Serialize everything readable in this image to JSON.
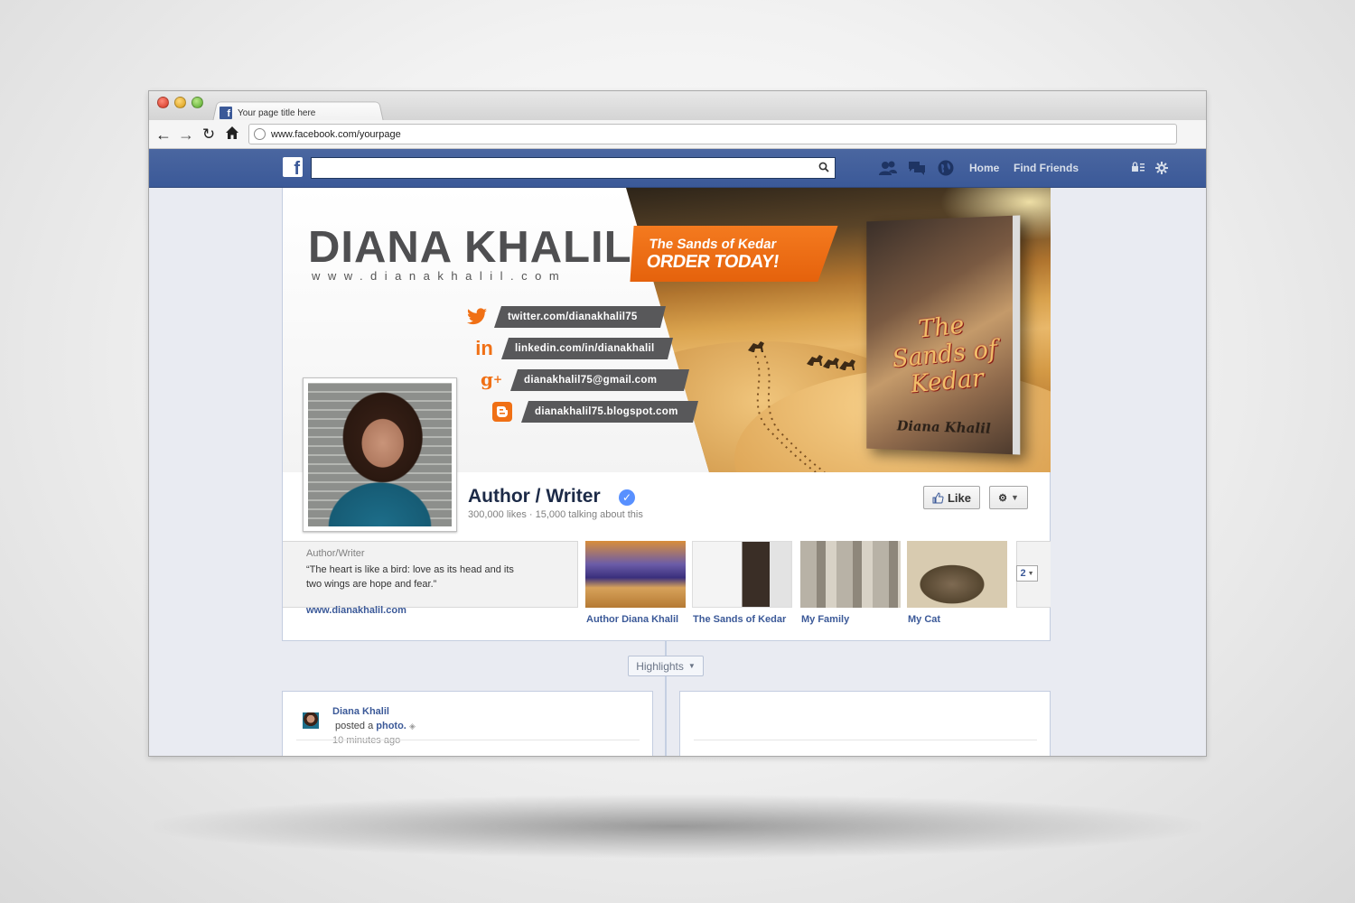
{
  "browser": {
    "tab_title": "Your page title here",
    "url": "www.facebook.com/yourpage"
  },
  "fb_nav": {
    "search_placeholder": "",
    "home_label": "Home",
    "find_friends_label": "Find Friends"
  },
  "cover": {
    "author_name": "DIANA KHALIL",
    "website": "www.dianakhalil.com",
    "promo_line1": "The Sands of Kedar",
    "promo_line2": "ORDER TODAY!",
    "social": [
      {
        "icon": "twitter-icon",
        "text": "twitter.com/dianakhalil75"
      },
      {
        "icon": "linkedin-icon",
        "text": "linkedin.com/in/dianakhalil"
      },
      {
        "icon": "google-plus-icon",
        "text": "dianakhalil75@gmail.com"
      },
      {
        "icon": "blogger-icon",
        "text": "dianakhalil75.blogspot.com"
      }
    ],
    "book_title": "The Sands of Kedar",
    "book_author": "Diana Khalil",
    "accent_color": "#f07015"
  },
  "page": {
    "title": "Author / Writer",
    "stats": "300,000 likes · 15,000 talking about this",
    "like_label": "Like"
  },
  "about": {
    "label": "Author/Writer",
    "quote": "“The heart is like a bird: love as its head and its two wings are hope and fear.”",
    "link": "www.dianakhalil.com"
  },
  "apps": [
    {
      "label": "Author Diana Khalil"
    },
    {
      "label": "The Sands of Kedar"
    },
    {
      "label": "My Family"
    },
    {
      "label": "My Cat"
    }
  ],
  "apps_more_count": "2",
  "timeline": {
    "highlights_label": "Highlights"
  },
  "post": {
    "author": "Diana Khalil",
    "action_prefix": "posted a ",
    "action_object": "photo.",
    "time": "10 minutes ago"
  }
}
